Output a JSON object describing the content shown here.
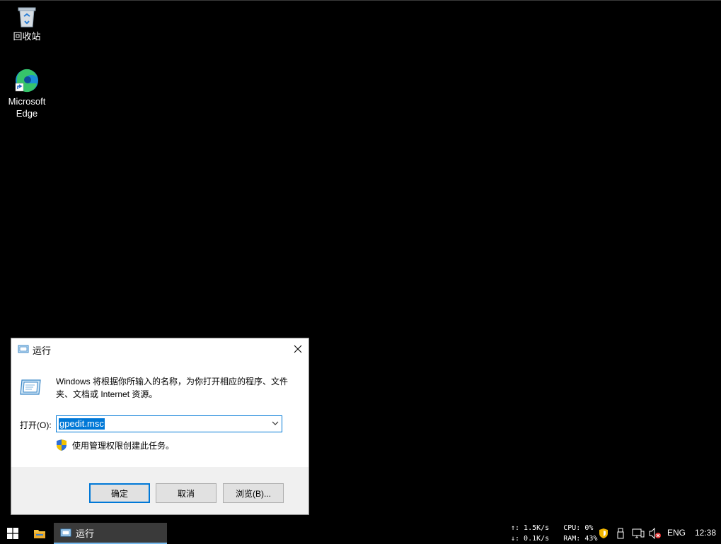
{
  "desktop": {
    "icons": [
      {
        "label": "回收站",
        "icon": "recycle-bin-icon"
      },
      {
        "label": "Microsoft\nEdge",
        "icon": "edge-icon"
      }
    ]
  },
  "dialog": {
    "title": "运行",
    "description": "Windows 将根据你所输入的名称，为你打开相应的程序、文件夹、文档或 Internet 资源。",
    "open_label": "打开(O):",
    "input_value": "gpedit.msc",
    "admin_note": "使用管理权限创建此任务。",
    "buttons": {
      "ok": "确定",
      "cancel": "取消",
      "browse": "浏览(B)..."
    }
  },
  "taskbar": {
    "active_item": "运行",
    "net": {
      "up": "↑: 1.5K/s",
      "down": "↓: 0.1K/s",
      "cpu": "CPU: 0%",
      "ram": "RAM: 43%"
    },
    "language": "ENG",
    "time": "12:38"
  },
  "colors": {
    "accent": "#0078d7",
    "desktop": "#000000"
  }
}
